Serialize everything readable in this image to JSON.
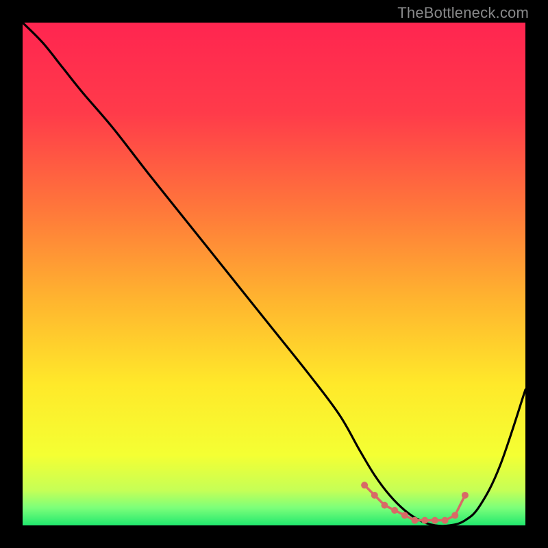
{
  "watermark": "TheBottleneck.com",
  "chart_data": {
    "type": "line",
    "title": "",
    "xlabel": "",
    "ylabel": "",
    "xlim": [
      0,
      100
    ],
    "ylim": [
      0,
      100
    ],
    "grid": false,
    "gradient_stops": [
      {
        "offset": 0,
        "color": "#ff2550"
      },
      {
        "offset": 0.18,
        "color": "#ff3b4a"
      },
      {
        "offset": 0.38,
        "color": "#ff7a3a"
      },
      {
        "offset": 0.55,
        "color": "#ffb42f"
      },
      {
        "offset": 0.72,
        "color": "#ffe92a"
      },
      {
        "offset": 0.86,
        "color": "#f4ff33"
      },
      {
        "offset": 0.93,
        "color": "#c6ff56"
      },
      {
        "offset": 0.965,
        "color": "#7cff7a"
      },
      {
        "offset": 1.0,
        "color": "#21e86e"
      }
    ],
    "series": [
      {
        "name": "bottleneck-curve",
        "x": [
          0,
          4,
          8,
          12,
          18,
          25,
          33,
          41,
          49,
          57,
          63,
          67,
          70,
          73,
          76,
          79,
          82,
          85,
          88,
          91,
          95,
          100
        ],
        "y": [
          100,
          96,
          91,
          86,
          79,
          70,
          60,
          50,
          40,
          30,
          22,
          15,
          10,
          6,
          3,
          1,
          0,
          0,
          1,
          4,
          12,
          27
        ]
      }
    ],
    "markers": {
      "name": "flat-bottom-dots",
      "color": "#d86a66",
      "radius": 5,
      "x": [
        68,
        70,
        72,
        74,
        76,
        78,
        80,
        82,
        84,
        86,
        88
      ],
      "y": [
        8,
        6,
        4,
        3,
        2,
        1,
        1,
        1,
        1,
        2,
        6
      ]
    }
  }
}
